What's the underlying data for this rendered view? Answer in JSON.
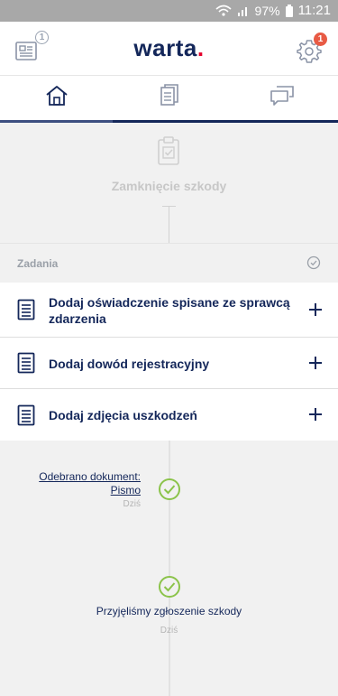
{
  "status_bar": {
    "battery": "97%",
    "time": "11:21",
    "icons": [
      "wifi-icon",
      "signal-icon",
      "battery-icon"
    ]
  },
  "app_bar": {
    "logo_text": "warta",
    "logo_dot": ".",
    "news_badge": "1",
    "settings_badge": "1",
    "icons": [
      "news-icon",
      "gear-icon"
    ]
  },
  "tabs": [
    {
      "icon": "home-icon",
      "active": true
    },
    {
      "icon": "documents-icon",
      "active": false
    },
    {
      "icon": "chat-icon",
      "active": false
    }
  ],
  "claim_status": {
    "icon": "clipboard-check-icon",
    "title": "Zamknięcie szkody"
  },
  "tasks_section": {
    "label": "Zadania",
    "icon": "check-circle-icon"
  },
  "tasks": [
    {
      "label": "Dodaj oświadczenie spisane ze sprawcą zdarzenia",
      "icon": "document-icon",
      "action_icon": "plus-icon"
    },
    {
      "label": "Dodaj dowód rejestracyjny",
      "icon": "document-icon",
      "action_icon": "plus-icon"
    },
    {
      "label": "Dodaj zdjęcia uszkodzeń",
      "icon": "document-icon",
      "action_icon": "plus-icon"
    }
  ],
  "timeline": [
    {
      "title_line1": "Odebrano dokument:",
      "title_line2": "Pismo",
      "date": "Dziś"
    },
    {
      "title": "Przyjęliśmy zgłoszenie szkody",
      "date": "Dziś"
    }
  ],
  "colors": {
    "brand_navy": "#14275a",
    "brand_red": "#e4002b",
    "success_green": "#8bc34a",
    "badge_red": "#e85a44"
  }
}
